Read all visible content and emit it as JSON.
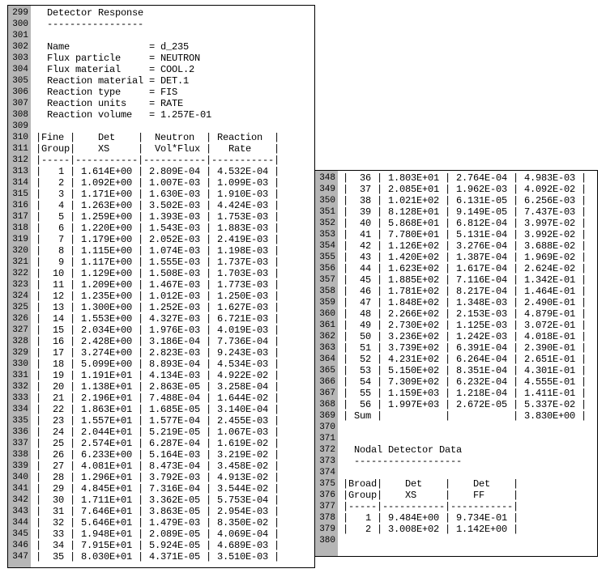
{
  "section_title": "Detector Response",
  "section_rule": "-----------------",
  "params": {
    "Name": "d_235",
    "Flux particle": "NEUTRON",
    "Flux material": "COOL.2",
    "Reaction material": "DET.1",
    "Reaction type": "FIS",
    "Reaction units": "RATE",
    "Reaction volume": "1.257E-01"
  },
  "fine_table": {
    "headers": [
      "Fine",
      "Det",
      "Neutron",
      "Reaction"
    ],
    "headers2": [
      "Group",
      "XS",
      "Vol*Flux",
      "Rate"
    ],
    "rows": [
      {
        "g": 1,
        "xs": "1.614E+00",
        "vf": "2.809E-04",
        "r": "4.532E-04"
      },
      {
        "g": 2,
        "xs": "1.092E+00",
        "vf": "1.007E-03",
        "r": "1.099E-03"
      },
      {
        "g": 3,
        "xs": "1.171E+00",
        "vf": "1.630E-03",
        "r": "1.910E-03"
      },
      {
        "g": 4,
        "xs": "1.263E+00",
        "vf": "3.502E-03",
        "r": "4.424E-03"
      },
      {
        "g": 5,
        "xs": "1.259E+00",
        "vf": "1.393E-03",
        "r": "1.753E-03"
      },
      {
        "g": 6,
        "xs": "1.220E+00",
        "vf": "1.543E-03",
        "r": "1.883E-03"
      },
      {
        "g": 7,
        "xs": "1.179E+00",
        "vf": "2.052E-03",
        "r": "2.419E-03"
      },
      {
        "g": 8,
        "xs": "1.115E+00",
        "vf": "1.074E-03",
        "r": "1.198E-03"
      },
      {
        "g": 9,
        "xs": "1.117E+00",
        "vf": "1.555E-03",
        "r": "1.737E-03"
      },
      {
        "g": 10,
        "xs": "1.129E+00",
        "vf": "1.508E-03",
        "r": "1.703E-03"
      },
      {
        "g": 11,
        "xs": "1.209E+00",
        "vf": "1.467E-03",
        "r": "1.773E-03"
      },
      {
        "g": 12,
        "xs": "1.235E+00",
        "vf": "1.012E-03",
        "r": "1.250E-03"
      },
      {
        "g": 13,
        "xs": "1.300E+00",
        "vf": "1.252E-03",
        "r": "1.627E-03"
      },
      {
        "g": 14,
        "xs": "1.553E+00",
        "vf": "4.327E-03",
        "r": "6.721E-03"
      },
      {
        "g": 15,
        "xs": "2.034E+00",
        "vf": "1.976E-03",
        "r": "4.019E-03"
      },
      {
        "g": 16,
        "xs": "2.428E+00",
        "vf": "3.186E-04",
        "r": "7.736E-04"
      },
      {
        "g": 17,
        "xs": "3.274E+00",
        "vf": "2.823E-03",
        "r": "9.243E-03"
      },
      {
        "g": 18,
        "xs": "5.099E+00",
        "vf": "8.893E-04",
        "r": "4.534E-03"
      },
      {
        "g": 19,
        "xs": "1.191E+01",
        "vf": "4.134E-03",
        "r": "4.922E-02"
      },
      {
        "g": 20,
        "xs": "1.138E+01",
        "vf": "2.863E-05",
        "r": "3.258E-04"
      },
      {
        "g": 21,
        "xs": "2.196E+01",
        "vf": "7.488E-04",
        "r": "1.644E-02"
      },
      {
        "g": 22,
        "xs": "1.863E+01",
        "vf": "1.685E-05",
        "r": "3.140E-04"
      },
      {
        "g": 23,
        "xs": "1.557E+01",
        "vf": "1.577E-04",
        "r": "2.455E-03"
      },
      {
        "g": 24,
        "xs": "2.044E+01",
        "vf": "5.219E-05",
        "r": "1.067E-03"
      },
      {
        "g": 25,
        "xs": "2.574E+01",
        "vf": "6.287E-04",
        "r": "1.619E-02"
      },
      {
        "g": 26,
        "xs": "6.233E+00",
        "vf": "5.164E-03",
        "r": "3.219E-02"
      },
      {
        "g": 27,
        "xs": "4.081E+01",
        "vf": "8.473E-04",
        "r": "3.458E-02"
      },
      {
        "g": 28,
        "xs": "1.296E+01",
        "vf": "3.792E-03",
        "r": "4.913E-02"
      },
      {
        "g": 29,
        "xs": "4.845E+01",
        "vf": "7.316E-04",
        "r": "3.544E-02"
      },
      {
        "g": 30,
        "xs": "1.711E+01",
        "vf": "3.362E-05",
        "r": "5.753E-04"
      },
      {
        "g": 31,
        "xs": "7.646E+01",
        "vf": "3.863E-05",
        "r": "2.954E-03"
      },
      {
        "g": 32,
        "xs": "5.646E+01",
        "vf": "1.479E-03",
        "r": "8.350E-02"
      },
      {
        "g": 33,
        "xs": "1.948E+01",
        "vf": "2.089E-05",
        "r": "4.069E-04"
      },
      {
        "g": 34,
        "xs": "7.915E+01",
        "vf": "5.924E-05",
        "r": "4.689E-03"
      },
      {
        "g": 35,
        "xs": "8.030E+01",
        "vf": "4.371E-05",
        "r": "3.510E-03"
      },
      {
        "g": 36,
        "xs": "1.803E+01",
        "vf": "2.764E-04",
        "r": "4.983E-03"
      },
      {
        "g": 37,
        "xs": "2.085E+01",
        "vf": "1.962E-03",
        "r": "4.092E-02"
      },
      {
        "g": 38,
        "xs": "1.021E+02",
        "vf": "6.131E-05",
        "r": "6.256E-03"
      },
      {
        "g": 39,
        "xs": "8.128E+01",
        "vf": "9.149E-05",
        "r": "7.437E-03"
      },
      {
        "g": 40,
        "xs": "5.868E+01",
        "vf": "6.812E-04",
        "r": "3.997E-02"
      },
      {
        "g": 41,
        "xs": "7.780E+01",
        "vf": "5.131E-04",
        "r": "3.992E-02"
      },
      {
        "g": 42,
        "xs": "1.126E+02",
        "vf": "3.276E-04",
        "r": "3.688E-02"
      },
      {
        "g": 43,
        "xs": "1.420E+02",
        "vf": "1.387E-04",
        "r": "1.969E-02"
      },
      {
        "g": 44,
        "xs": "1.623E+02",
        "vf": "1.617E-04",
        "r": "2.624E-02"
      },
      {
        "g": 45,
        "xs": "1.885E+02",
        "vf": "7.116E-04",
        "r": "1.342E-01"
      },
      {
        "g": 46,
        "xs": "1.781E+02",
        "vf": "8.217E-04",
        "r": "1.464E-01"
      },
      {
        "g": 47,
        "xs": "1.848E+02",
        "vf": "1.348E-03",
        "r": "2.490E-01"
      },
      {
        "g": 48,
        "xs": "2.266E+02",
        "vf": "2.153E-03",
        "r": "4.879E-01"
      },
      {
        "g": 49,
        "xs": "2.730E+02",
        "vf": "1.125E-03",
        "r": "3.072E-01"
      },
      {
        "g": 50,
        "xs": "3.236E+02",
        "vf": "1.242E-03",
        "r": "4.018E-01"
      },
      {
        "g": 51,
        "xs": "3.739E+02",
        "vf": "6.391E-04",
        "r": "2.390E-01"
      },
      {
        "g": 52,
        "xs": "4.231E+02",
        "vf": "6.264E-04",
        "r": "2.651E-01"
      },
      {
        "g": 53,
        "xs": "5.150E+02",
        "vf": "8.351E-04",
        "r": "4.301E-01"
      },
      {
        "g": 54,
        "xs": "7.309E+02",
        "vf": "6.232E-04",
        "r": "4.555E-01"
      },
      {
        "g": 55,
        "xs": "1.159E+03",
        "vf": "1.218E-04",
        "r": "1.411E-01"
      },
      {
        "g": 56,
        "xs": "1.997E+03",
        "vf": "2.672E-05",
        "r": "5.337E-02"
      }
    ],
    "sum_label": "Sum",
    "sum_rate": "3.830E+00"
  },
  "nodal": {
    "title": "Nodal Detector Data",
    "rule": "-------------------",
    "headers": [
      "Broad",
      "Det",
      "Det"
    ],
    "headers2": [
      "Group",
      "XS",
      "FF"
    ],
    "rows": [
      {
        "g": 1,
        "xs": "9.484E+00",
        "ff": "9.734E-01"
      },
      {
        "g": 2,
        "xs": "3.008E+02",
        "ff": "1.142E+00"
      }
    ]
  },
  "left_line_start": 299,
  "left_line_end": 347,
  "right_line_start": 348,
  "right_line_end": 380
}
